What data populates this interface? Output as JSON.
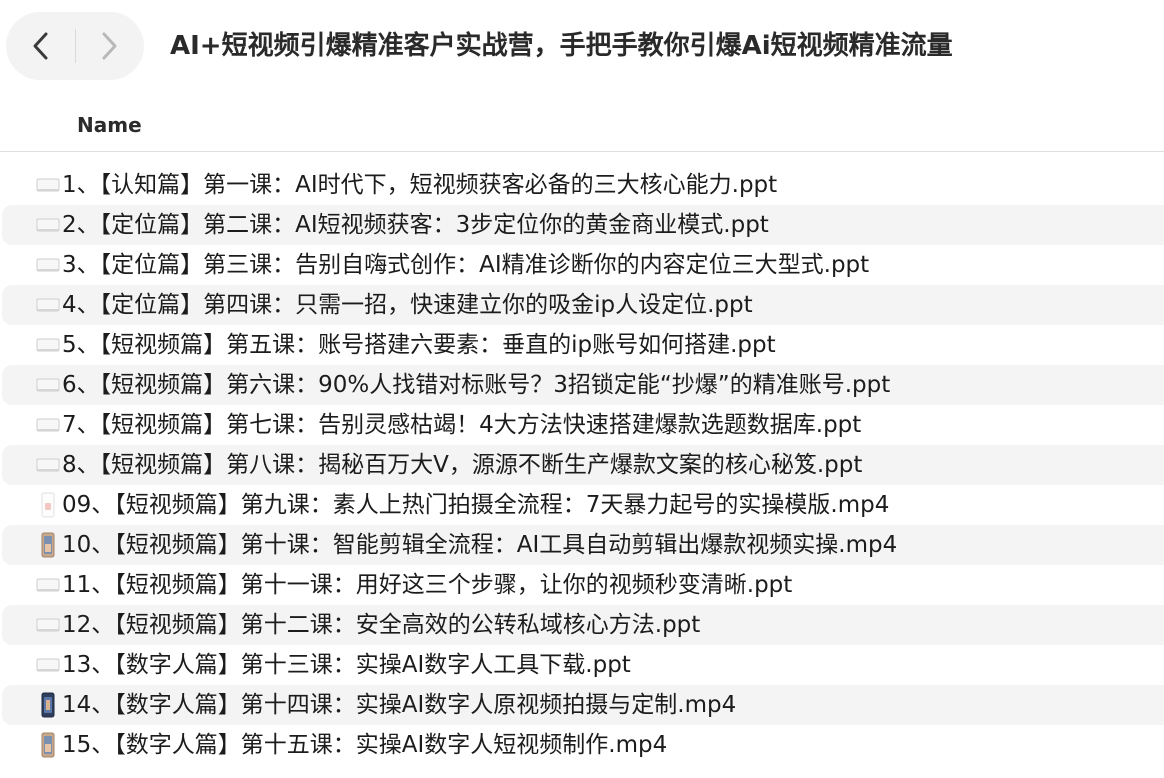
{
  "window": {
    "title": "AI+短视频引爆精准客户实战营，手把手教你引爆Ai短视频精准流量"
  },
  "columns": {
    "name": "Name"
  },
  "files": [
    {
      "name": "1、【认知篇】第一课：AI时代下，短视频获客必备的三大核心能力.ppt",
      "icon": "document-icon"
    },
    {
      "name": "2、【定位篇】第二课：AI短视频获客：3步定位你的黄金商业模式.ppt",
      "icon": "document-icon"
    },
    {
      "name": "3、【定位篇】第三课：告别自嗨式创作：AI精准诊断你的内容定位三大型式.ppt",
      "icon": "document-icon"
    },
    {
      "name": "4、【定位篇】第四课：只需一招，快速建立你的吸金ip人设定位.ppt",
      "icon": "document-icon"
    },
    {
      "name": "5、【短视频篇】第五课：账号搭建六要素：垂直的ip账号如何搭建.ppt",
      "icon": "document-icon"
    },
    {
      "name": "6、【短视频篇】第六课：90%人找错对标账号？3招锁定能“抄爆”的精准账号.ppt",
      "icon": "document-icon"
    },
    {
      "name": "7、【短视频篇】第七课：告别灵感枯竭！4大方法快速搭建爆款选题数据库.ppt",
      "icon": "document-icon"
    },
    {
      "name": "8、【短视频篇】第八课：揭秘百万大V，源源不断生产爆款文案的核心秘笈.ppt",
      "icon": "document-icon"
    },
    {
      "name": "09、【短视频篇】第九课：素人上热门拍摄全流程：7天暴力起号的实操模版.mp4",
      "icon": "video-thumbnail-icon"
    },
    {
      "name": "10、【短视频篇】第十课：智能剪辑全流程：AI工具自动剪辑出爆款视频实操.mp4",
      "icon": "video-thumbnail-icon"
    },
    {
      "name": "11、【短视频篇】第十一课：用好这三个步骤，让你的视频秒变清晰.ppt",
      "icon": "document-icon"
    },
    {
      "name": "12、【短视频篇】第十二课：安全高效的公转私域核心方法.ppt",
      "icon": "document-icon"
    },
    {
      "name": "13、【数字人篇】第十三课：实操AI数字人工具下载.ppt",
      "icon": "document-icon"
    },
    {
      "name": "14、【数字人篇】第十四课：实操AI数字人原视频拍摄与定制.mp4",
      "icon": "video-thumbnail-icon"
    },
    {
      "name": "15、【数字人篇】第十五课：实操AI数字人短视频制作.mp4",
      "icon": "video-thumbnail-icon"
    }
  ],
  "colors": {
    "row_alt": "#f4f4f5",
    "nav_bg": "#f3f3f3",
    "text": "#1c1c1c"
  }
}
